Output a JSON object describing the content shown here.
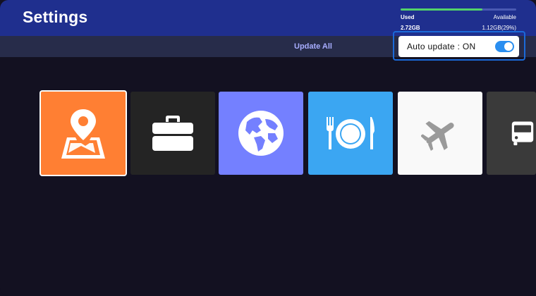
{
  "header": {
    "title": "Settings"
  },
  "storage": {
    "used_label": "Used",
    "available_label": "Available",
    "used_value": "2.72GB",
    "available_value": "1.12GB(29%)",
    "used_fraction": 0.71,
    "bar_fill_color": "#53d36a"
  },
  "toolbar": {
    "update_all_label": "Update All",
    "auto_update_label": "Auto update : ON",
    "auto_update_on": true
  },
  "apps": [
    {
      "icon": "map-pin-icon",
      "color": "#ff7f33"
    },
    {
      "icon": "briefcase-icon",
      "color": "#242424"
    },
    {
      "icon": "globe-icon",
      "color": "#7480ff"
    },
    {
      "icon": "fork-plate-knife-icon",
      "color": "#3ba6f2"
    },
    {
      "icon": "airplane-icon",
      "color": "#f9f9f9"
    },
    {
      "icon": "bus-icon",
      "color": "#3a3a3a"
    }
  ],
  "colors": {
    "header": "#1f2f8e",
    "background": "#131121",
    "focus_border": "#1b6ad9",
    "toggle_on": "#2a8ef0"
  }
}
